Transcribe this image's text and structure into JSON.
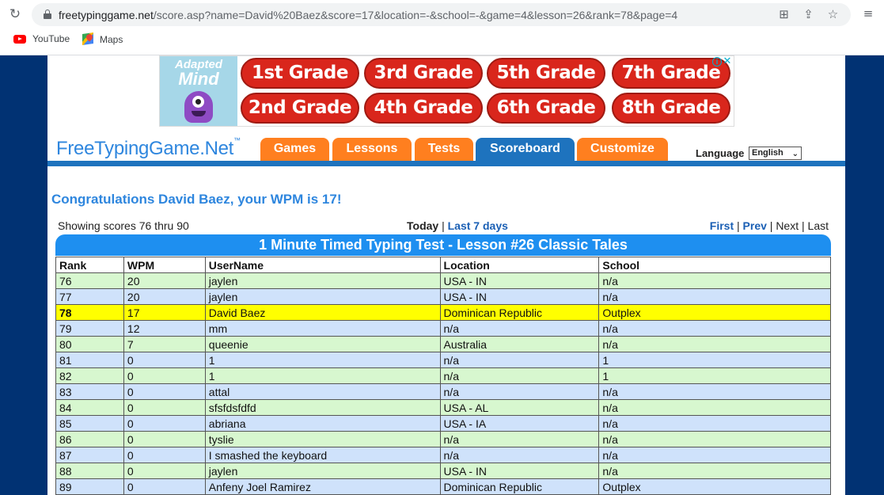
{
  "browser": {
    "url_host": "freetypinggame.net",
    "url_rest": "/score.asp?name=David%20Baez&score=17&location=-&school=-&game=4&lesson=26&rank=78&page=4",
    "bookmarks": [
      "YouTube",
      "Maps"
    ]
  },
  "ad": {
    "brand_top": "Adapted",
    "brand_bottom": "Mind",
    "grades": [
      "1st Grade",
      "3rd Grade",
      "5th Grade",
      "7th Grade",
      "2nd Grade",
      "4th Grade",
      "6th Grade",
      "8th Grade"
    ]
  },
  "site": {
    "logo": "FreeTypingGame.Net",
    "logo_mark": "™",
    "tabs": [
      "Games",
      "Lessons",
      "Tests",
      "Scoreboard",
      "Customize"
    ],
    "active_tab": "Scoreboard",
    "language_label": "Language",
    "language_value": "English"
  },
  "congrats": "Congratulations David Baez, your WPM is 17!",
  "showing": "Showing scores 76 thru 90",
  "period": {
    "today": "Today",
    "sep": "|",
    "last7": "Last 7 days"
  },
  "pager": {
    "first": "First",
    "prev": "Prev",
    "next": "Next",
    "last": "Last",
    "sep": "|"
  },
  "table": {
    "title": "1 Minute Timed Typing Test - Lesson #26 Classic Tales",
    "headers": [
      "Rank",
      "WPM",
      "UserName",
      "Location",
      "School"
    ],
    "rows": [
      {
        "style": "green",
        "cells": [
          "76",
          "20",
          "jaylen",
          "USA - IN",
          "n/a"
        ]
      },
      {
        "style": "blue",
        "cells": [
          "77",
          "20",
          "jaylen",
          "USA - IN",
          "n/a"
        ]
      },
      {
        "style": "yellow",
        "cells": [
          "78",
          "17",
          "David Baez",
          "Dominican Republic",
          "Outplex"
        ]
      },
      {
        "style": "blue",
        "cells": [
          "79",
          "12",
          "mm",
          "n/a",
          "n/a"
        ]
      },
      {
        "style": "green",
        "cells": [
          "80",
          "7",
          "queenie",
          "Australia",
          "n/a"
        ]
      },
      {
        "style": "blue",
        "cells": [
          "81",
          "0",
          "1",
          "n/a",
          "1"
        ]
      },
      {
        "style": "green",
        "cells": [
          "82",
          "0",
          "1",
          "n/a",
          "1"
        ]
      },
      {
        "style": "blue",
        "cells": [
          "83",
          "0",
          "attal",
          "n/a",
          "n/a"
        ]
      },
      {
        "style": "green",
        "cells": [
          "84",
          "0",
          "sfsfdsfdfd",
          "USA - AL",
          "n/a"
        ]
      },
      {
        "style": "blue",
        "cells": [
          "85",
          "0",
          "abriana",
          "USA - IA",
          "n/a"
        ]
      },
      {
        "style": "green",
        "cells": [
          "86",
          "0",
          "tyslie",
          "n/a",
          "n/a"
        ]
      },
      {
        "style": "blue",
        "cells": [
          "87",
          "0",
          "I smashed the keyboard",
          "n/a",
          "n/a"
        ]
      },
      {
        "style": "green",
        "cells": [
          "88",
          "0",
          "jaylen",
          "USA - IN",
          "n/a"
        ]
      },
      {
        "style": "blue",
        "cells": [
          "89",
          "0",
          "Anfeny Joel Ramirez",
          "Dominican Republic",
          "Outplex"
        ]
      }
    ]
  }
}
